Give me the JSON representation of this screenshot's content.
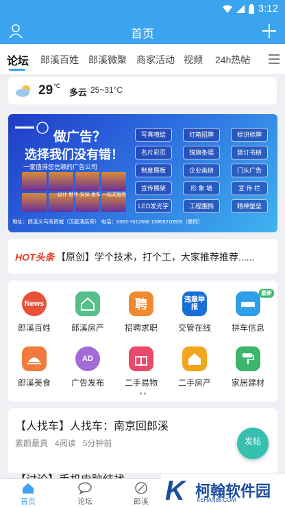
{
  "status_bar": {
    "time": "3:12"
  },
  "app_bar": {
    "title": "首页"
  },
  "tabs": [
    "论坛",
    "郎溪百姓",
    "郎溪微聚",
    "商家活动",
    "视频",
    "24h热帖"
  ],
  "weather": {
    "temp": "29",
    "unit": "℃",
    "condition": "多云",
    "range": "25~31°C"
  },
  "banner": {
    "headline1": "做广告？",
    "headline2": "选择我们没有错！",
    "subline": "一家值得您信赖的广告公司",
    "middle": "设计·制作·安装·发布 一站式服务",
    "services": [
      "写真喷绘",
      "灯箱招牌",
      "标识标牌",
      "名片彩页",
      "锦旗条幅",
      "装订书册",
      "制度展板",
      "企业画册",
      "门头广告",
      "宣传展架",
      "形 象 墙",
      "宣 传 栏",
      "LED发光字",
      "工程围挡",
      "精神堡垒"
    ],
    "footer": "地址：郎溪义乌商贸城（汉庭酒店旁）     电话：0563-7012666   13966210555（微同）"
  },
  "news_ticker": {
    "badge": "HOT头条",
    "text": "【原创】学个技术，打个工，大家推荐推荐......"
  },
  "services_grid": [
    {
      "label": "郎溪百姓",
      "icon": "News",
      "color": "#e8513a"
    },
    {
      "label": "郎溪房产",
      "icon": "house",
      "color": "#55c08a"
    },
    {
      "label": "招聘求职",
      "icon": "聘",
      "color": "#f08a2e"
    },
    {
      "label": "交管在线",
      "icon": "违章举报",
      "color": "#1a6fd6"
    },
    {
      "label": "拼车信息",
      "icon": "car",
      "color": "#2f9ee8",
      "tag": "最新"
    },
    {
      "label": "郎溪美食",
      "icon": "food",
      "color": "#f07b3c"
    },
    {
      "label": "广告发布",
      "icon": "AD",
      "color": "#a46ad8"
    },
    {
      "label": "二手易物",
      "icon": "gift",
      "color": "#ea4a6a"
    },
    {
      "label": "二手房产",
      "icon": "home",
      "color": "#f3a51c"
    },
    {
      "label": "家居建材",
      "icon": "tool",
      "color": "#3ab56a"
    }
  ],
  "posts": [
    {
      "title": "【人找车】人找车：南京回郎溪",
      "author": "素颜最真",
      "reads": "4阅读",
      "time": "5分钟前"
    },
    {
      "title": "【讨论】手机电脑结找"
    }
  ],
  "fab": {
    "label": "发帖"
  },
  "bottom_nav": [
    "首页",
    "论坛",
    "郎溪"
  ],
  "watermark": {
    "letter": "K",
    "title": "柯翰软件园",
    "url": "KEHAN88.COM"
  }
}
